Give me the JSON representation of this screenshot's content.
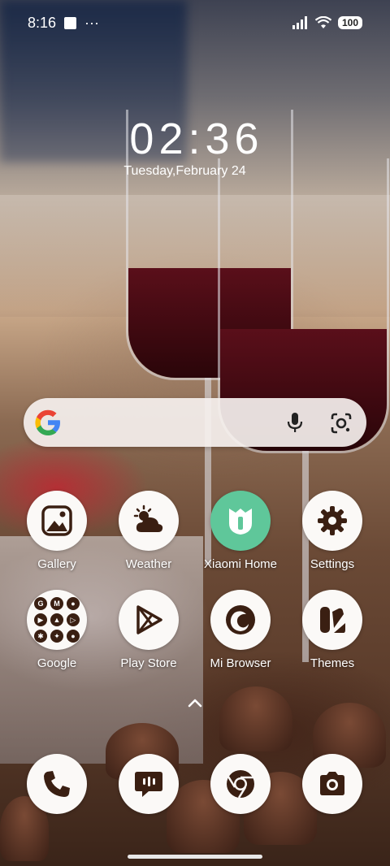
{
  "status_bar": {
    "time": "8:16",
    "more": "···",
    "battery": "100"
  },
  "clock": {
    "time": "02:36",
    "date": "Tuesday,February 24"
  },
  "search_bar": {
    "placeholder": ""
  },
  "apps_row1": [
    {
      "label": "Gallery",
      "icon": "gallery-icon"
    },
    {
      "label": "Weather",
      "icon": "weather-icon"
    },
    {
      "label": "Xiaomi Home",
      "icon": "xiaomi-home-icon"
    },
    {
      "label": "Settings",
      "icon": "settings-gear-icon"
    }
  ],
  "apps_row2": [
    {
      "label": "Google",
      "icon": "google-folder-icon"
    },
    {
      "label": "Play Store",
      "icon": "play-store-icon"
    },
    {
      "label": "Mi Browser",
      "icon": "mi-browser-icon"
    },
    {
      "label": "Themes",
      "icon": "themes-icon"
    }
  ],
  "dock": [
    {
      "icon": "phone-icon"
    },
    {
      "icon": "messages-icon"
    },
    {
      "icon": "chrome-icon"
    },
    {
      "icon": "camera-icon"
    }
  ],
  "colors": {
    "icon_dark": "#3a1f12",
    "xiaomi_green": "#5fc79a",
    "search_bg": "#f5f0ee"
  }
}
